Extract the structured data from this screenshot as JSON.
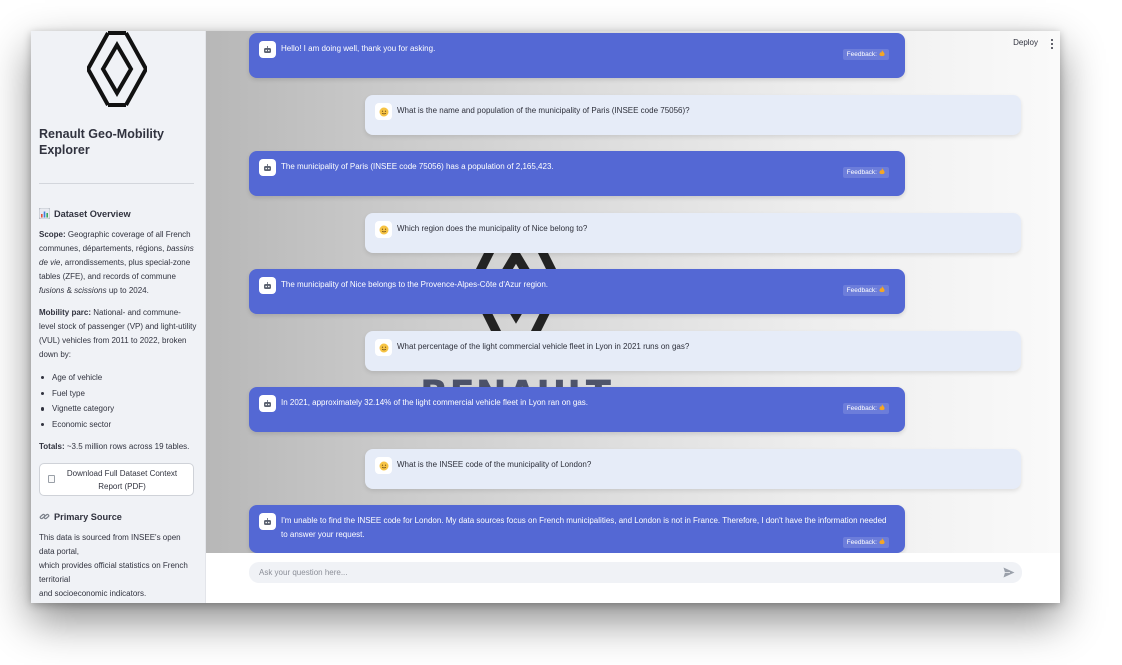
{
  "sidebar": {
    "app_title": "Renault Geo-Mobility Explorer",
    "dataset_overview": {
      "heading": "Dataset Overview",
      "scope_label": "Scope:",
      "scope_text_a": " Geographic coverage of all French communes, départements, régions, ",
      "scope_italic_a": "bassins de vie",
      "scope_text_b": ", arrondissements, plus special-zone tables (ZFE), and records of commune ",
      "scope_italic_b": "fusions",
      "scope_text_c": " & ",
      "scope_italic_c": "scissions",
      "scope_text_d": " up to 2024.",
      "mobility_label": "Mobility parc:",
      "mobility_text": " National- and commune-level stock of passenger (VP) and light-utility (VUL) vehicles from 2011 to 2022, broken down by:",
      "breakdown": [
        "Age of vehicle",
        "Fuel type",
        "Vignette category",
        "Economic sector"
      ],
      "totals_label": "Totals:",
      "totals_text": " ~3.5 million rows across 19 tables.",
      "download_label": "Download Full Dataset Context Report (PDF)"
    },
    "primary_source": {
      "heading": "Primary Source",
      "text": "This data is sourced from INSEE's open data portal,\nwhich provides official statistics on French territorial\nand socioeconomic indicators."
    }
  },
  "header": {
    "deploy_label": "Deploy"
  },
  "watermark": {
    "word": "RENAULT"
  },
  "messages": [
    {
      "role": "assistant",
      "text": "Hello! I am doing well, thank you for asking.",
      "feedback": "Feedback:"
    },
    {
      "role": "user",
      "text": "What is the name and population of the municipality of Paris (INSEE code 75056)?"
    },
    {
      "role": "assistant",
      "text": "The municipality of Paris (INSEE code 75056) has a population of 2,165,423.",
      "feedback": "Feedback:"
    },
    {
      "role": "user",
      "text": "Which region does the municipality of Nice belong to?"
    },
    {
      "role": "assistant",
      "text": "The municipality of Nice belongs to the Provence-Alpes-Côte d'Azur region.",
      "feedback": "Feedback:"
    },
    {
      "role": "user",
      "text": "What percentage of the light commercial vehicle fleet in Lyon in 2021 runs on gas?"
    },
    {
      "role": "assistant",
      "text": "In 2021, approximately 32.14% of the light commercial vehicle fleet in Lyon ran on gas.",
      "feedback": "Feedback:"
    },
    {
      "role": "user",
      "text": "What is the INSEE code of the municipality of London?"
    },
    {
      "role": "assistant",
      "text": "I'm unable to find the INSEE code for London. My data sources focus on French municipalities, and London is not in France. Therefore, I don't have the information needed to answer your request.",
      "feedback": "Feedback:"
    }
  ],
  "chat_input": {
    "placeholder": "Ask your question here..."
  },
  "colors": {
    "assistant_bubble": "#5468d4",
    "user_bubble": "#e6ecf8",
    "sidebar_bg": "#f0f2f6"
  },
  "icons": {
    "overview": "bar-chart-icon",
    "source": "link-icon",
    "assistant_avatar": "robot-icon",
    "user_avatar": "user-face-icon",
    "feedback": "fire-icon",
    "send": "send-arrow-icon"
  }
}
